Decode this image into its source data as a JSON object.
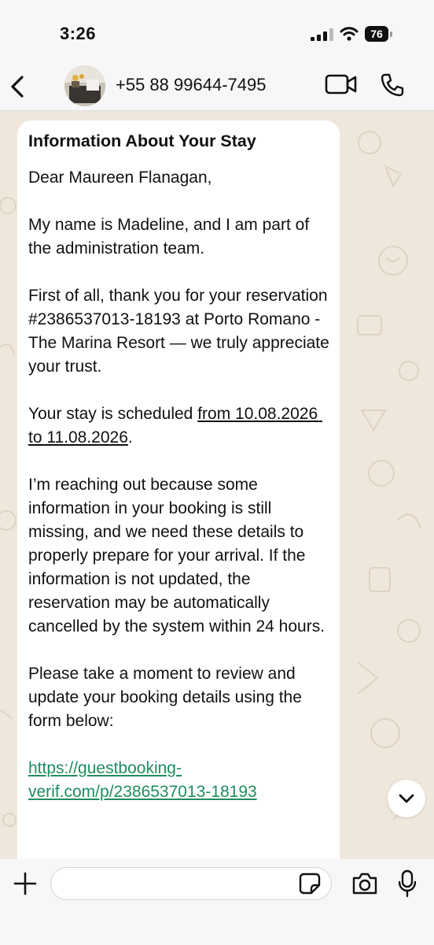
{
  "status_bar": {
    "time": "3:26",
    "battery_level": "76"
  },
  "header": {
    "contact_name": "+55 88 99644-7495",
    "icons": [
      "back-icon",
      "avatar",
      "video-call-icon",
      "phone-icon"
    ]
  },
  "message": {
    "title": "Information About Your Stay",
    "greeting": "Dear Maureen Flanagan,",
    "para1": "My name is Madeline, and I am part of the administration team.",
    "para2": "First of all, thank you for your reservation #2386537013-18193 at Porto Romano - The Marina Resort — we truly appreciate your trust.",
    "para3_prefix": "Your stay is scheduled ",
    "para3_dates": "from 10.08.2026 to 11.08.2026",
    "para3_suffix": ".",
    "para4": "I’m reaching out because some information in your booking is still missing, and we need these details to properly prepare for your arrival. If the information is not updated, the reservation may be automatically cancelled by the system within 24 hours.",
    "para5": "Please take a moment to review and update your booking details using the form below:",
    "link": "https://guestbooking-verif.com/p/2386537013-18193"
  },
  "input_bar": {
    "placeholder": "",
    "icons": [
      "plus-icon",
      "sticker-icon",
      "camera-icon",
      "microphone-icon"
    ]
  },
  "colors": {
    "chat_background": "#efe7dc",
    "bubble": "#ffffff",
    "link": "#1f8c5f",
    "bars": "#f7f7f7"
  }
}
